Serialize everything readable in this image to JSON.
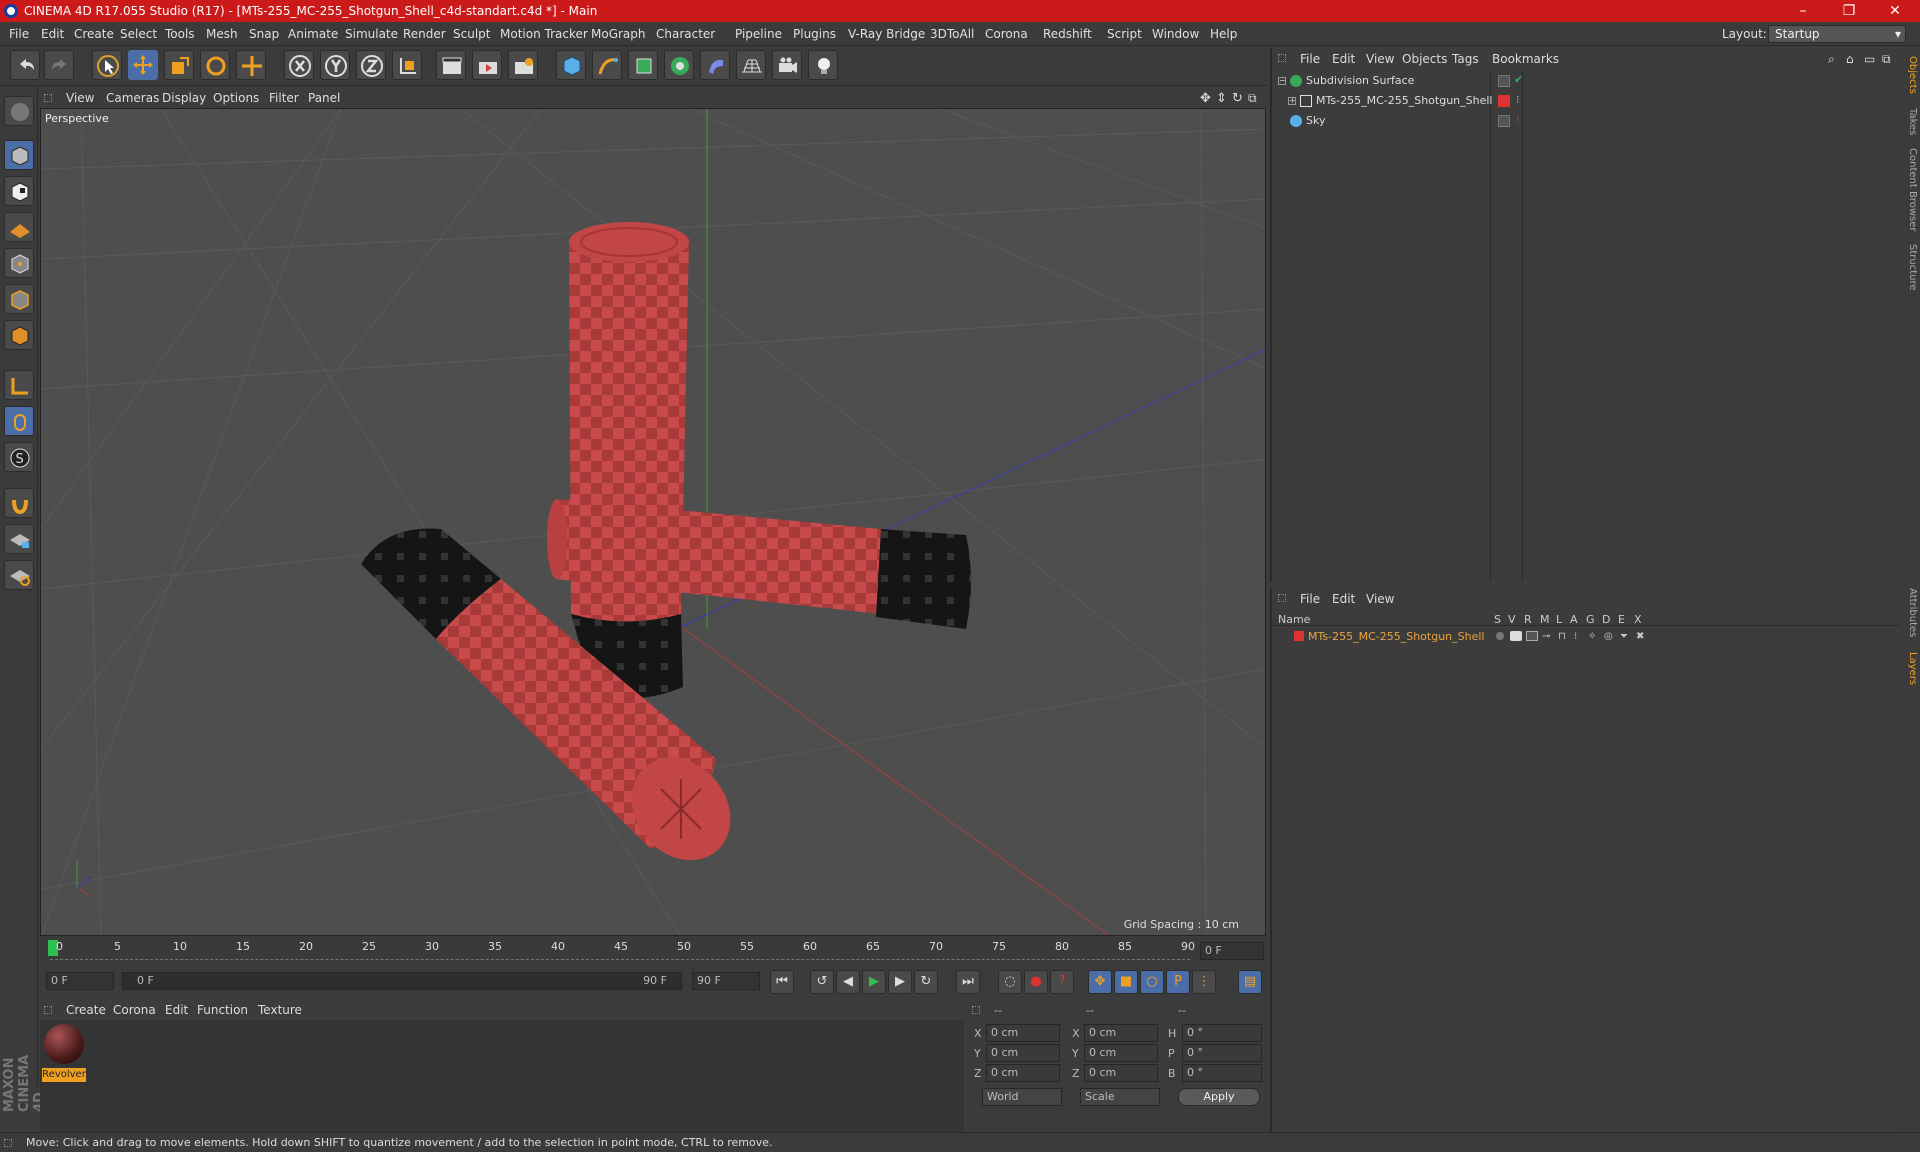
{
  "window": {
    "title": "CINEMA 4D R17.055 Studio (R17) - [MTs-255_MC-255_Shotgun_Shell_c4d-standart.c4d *] - Main",
    "minimize": "–",
    "maximize": "❐",
    "close": "✕"
  },
  "menubar": {
    "items": [
      "File",
      "Edit",
      "Create",
      "Select",
      "Tools",
      "Mesh",
      "Snap",
      "Animate",
      "Simulate",
      "Render",
      "Sculpt",
      "Motion Tracker",
      "MoGraph",
      "Character",
      "Pipeline",
      "Plugins",
      "V-Ray Bridge",
      "3DToAll",
      "Corona",
      "Redshift",
      "Script",
      "Window",
      "Help"
    ],
    "layout_label": "Layout:",
    "layout_value": "Startup"
  },
  "viewport": {
    "menu": [
      "View",
      "Cameras",
      "Display",
      "Options",
      "Filter",
      "Panel"
    ],
    "label": "Perspective",
    "grid_spacing": "Grid Spacing : 10 cm"
  },
  "timeline": {
    "ticks": [
      "0",
      "5",
      "10",
      "15",
      "20",
      "25",
      "30",
      "35",
      "40",
      "45",
      "50",
      "55",
      "60",
      "65",
      "70",
      "75",
      "80",
      "85",
      "90"
    ],
    "current_frame": "0 F",
    "start_field": "0 F",
    "range_start": "0 F",
    "range_end": "90 F",
    "end_field": "90 F"
  },
  "material_manager": {
    "menu": [
      "Create",
      "Corona",
      "Edit",
      "Function",
      "Texture"
    ],
    "material_name": "Revolver"
  },
  "attributes": {
    "header": [
      "--",
      "--",
      "--"
    ],
    "rows": [
      {
        "a": "X",
        "av": "0 cm",
        "b": "X",
        "bv": "0 cm",
        "c": "H",
        "cv": "0 °"
      },
      {
        "a": "Y",
        "av": "0 cm",
        "b": "Y",
        "bv": "0 cm",
        "c": "P",
        "cv": "0 °"
      },
      {
        "a": "Z",
        "av": "0 cm",
        "b": "Z",
        "bv": "0 cm",
        "c": "B",
        "cv": "0 °"
      }
    ],
    "world": "World",
    "scale": "Scale",
    "apply": "Apply"
  },
  "object_manager": {
    "menu": [
      "File",
      "Edit",
      "View",
      "Objects",
      "Tags",
      "Bookmarks"
    ],
    "objects": [
      "Subdivision Surface",
      "MTs-255_MC-255_Shotgun_Shell",
      "Sky"
    ]
  },
  "layer_manager": {
    "menu": [
      "File",
      "Edit",
      "View"
    ],
    "columns": [
      "Name",
      "S",
      "V",
      "R",
      "M",
      "L",
      "A",
      "G",
      "D",
      "E",
      "X"
    ],
    "layer_name": "MTs-255_MC-255_Shotgun_Shell"
  },
  "side_tabs": [
    "Objects",
    "Takes",
    "Content Browser",
    "Structure",
    "Attributes",
    "Layers"
  ],
  "branding": "MAXON CINEMA 4D",
  "status": "Move: Click and drag to move elements. Hold down SHIFT to quantize movement / add to the selection in point mode, CTRL to remove.",
  "colors": {
    "accent": "#cc1a1a",
    "selection": "#4b6ea8",
    "layer_text": "#e8a33d",
    "shell_red": "#c94a4a"
  }
}
